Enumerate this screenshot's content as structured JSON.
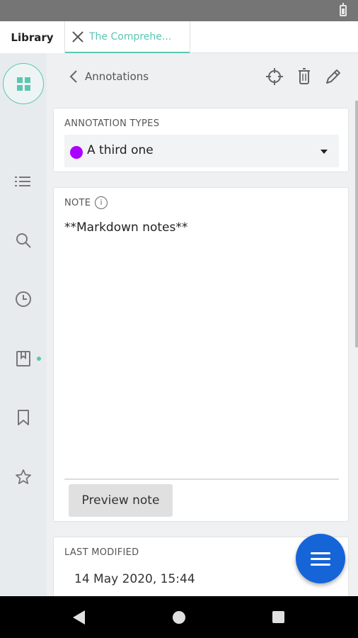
{
  "tabs": [
    {
      "label": "Library"
    },
    {
      "label": "The Comprehe..."
    }
  ],
  "rail": {
    "items": [
      {
        "icon": "grid-icon",
        "active": true
      },
      {
        "icon": "list-icon"
      },
      {
        "icon": "search-icon"
      },
      {
        "icon": "history-clock-icon"
      },
      {
        "icon": "annotations-book-icon",
        "indicator_color": "#5cc6b2"
      },
      {
        "icon": "bookmark-icon"
      },
      {
        "icon": "star-icon"
      }
    ]
  },
  "header": {
    "title": "Annotations",
    "actions": [
      "crosshair-icon",
      "trash-icon",
      "pencil-icon"
    ]
  },
  "annotation_types": {
    "label": "ANNOTATION TYPES",
    "selected": "A third one",
    "color": "#aa00ff"
  },
  "note": {
    "label": "NOTE",
    "info_glyph": "i",
    "text": "**Markdown notes**",
    "preview_button": "Preview note"
  },
  "last_modified": {
    "label": "LAST MODIFIED",
    "value": "14 May 2020, 15:44"
  },
  "colors": {
    "accent": "#5cc6b2",
    "fab": "#1565d8",
    "type_color": "#aa00ff"
  }
}
